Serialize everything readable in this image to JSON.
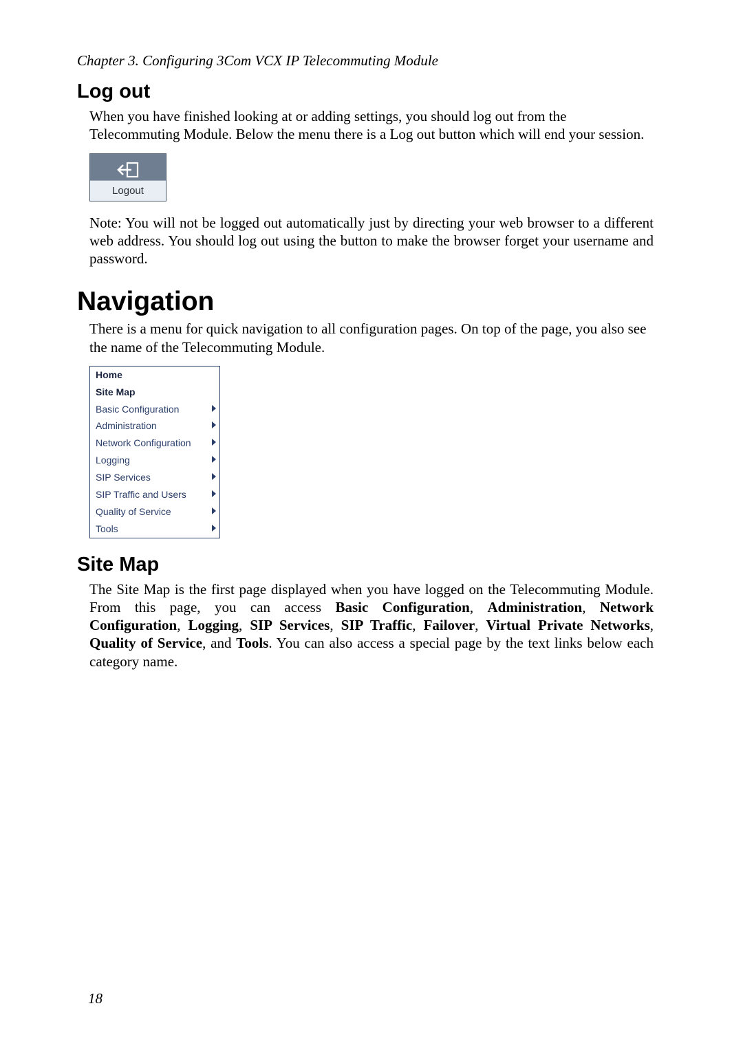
{
  "header": {
    "chapter_line": "Chapter 3. Configuring 3Com VCX IP Telecommuting Module"
  },
  "logout_section": {
    "heading": "Log out",
    "para1": "When you have finished looking at or adding settings, you should log out from the Telecommuting Module. Below the menu there is a Log out button which will end your session.",
    "button_label": "Logout",
    "note": "Note: You will not be logged out automatically just by directing your web browser to a different web address. You should log out using the button to make the browser forget your username and password."
  },
  "navigation_section": {
    "heading": "Navigation",
    "intro": "There is a menu for quick navigation to all configuration pages. On top of the page, you also see the name of the Telecommuting Module.",
    "menu_items": [
      {
        "label": "Home",
        "has_submenu": false,
        "bold": true
      },
      {
        "label": "Site Map",
        "has_submenu": false,
        "bold": true
      },
      {
        "label": "Basic Configuration",
        "has_submenu": true,
        "bold": false
      },
      {
        "label": "Administration",
        "has_submenu": true,
        "bold": false
      },
      {
        "label": "Network Configuration",
        "has_submenu": true,
        "bold": false
      },
      {
        "label": "Logging",
        "has_submenu": true,
        "bold": false
      },
      {
        "label": "SIP Services",
        "has_submenu": true,
        "bold": false
      },
      {
        "label": "SIP Traffic and Users",
        "has_submenu": true,
        "bold": false
      },
      {
        "label": "Quality of Service",
        "has_submenu": true,
        "bold": false
      },
      {
        "label": "Tools",
        "has_submenu": true,
        "bold": false
      }
    ]
  },
  "sitemap_section": {
    "heading": "Site Map",
    "para_prefix": "The Site Map is the first page displayed when you have logged on the Telecommuting Module. From this page, you can access ",
    "cats": [
      "Basic Configuration",
      "Administration",
      "Network Configuration",
      "Logging",
      "SIP Services",
      "SIP Traffic",
      "Failover",
      "Virtual Private Networks",
      "Quality of Service"
    ],
    "joiner_comma": ", ",
    "joiner_and": ", and ",
    "last_cat": "Tools",
    "para_suffix": ". You can also access a special page by the text links below each category name."
  },
  "page_number": "18"
}
